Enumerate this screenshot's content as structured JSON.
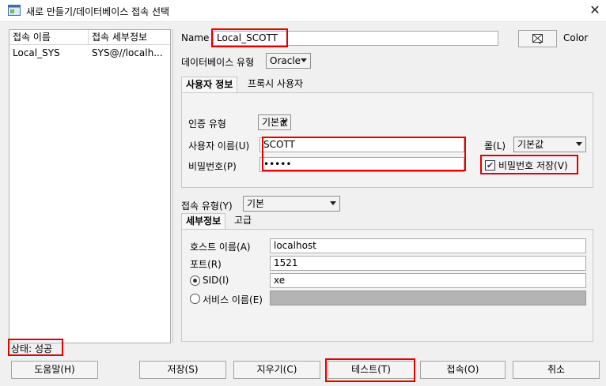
{
  "window": {
    "title": "새로 만들기/데이터베이스 접속 선택",
    "close_glyph": "✕"
  },
  "connections": {
    "headers": [
      "접속 이름",
      "접속 세부정보"
    ],
    "rows": [
      [
        "Local_SYS",
        "SYS@//localh..."
      ]
    ]
  },
  "form": {
    "name_label": "Name",
    "name_value": "Local_SCOTT",
    "color_label": "Color",
    "db_type_label": "데이터베이스 유형",
    "db_type_value": "Oracle",
    "user_tabs": [
      "사용자 정보",
      "프록시 사용자"
    ],
    "auth_type_label": "인증 유형",
    "auth_type_value": "기본값",
    "username_label": "사용자 이름(U)",
    "username_value": "SCOTT",
    "password_label": "비밀번호(P)",
    "password_value": "•••••",
    "role_label": "롤(L)",
    "role_value": "기본값",
    "save_password_label": "비밀번호 저장(V)",
    "save_password_checked": true,
    "conn_type_label": "접속 유형(Y)",
    "conn_type_value": "기본",
    "detail_tabs": [
      "세부정보",
      "고급"
    ],
    "host_label": "호스트 이름(A)",
    "host_value": "localhost",
    "port_label": "포트(R)",
    "port_value": "1521",
    "sid_label": "SID(I)",
    "sid_value": "xe",
    "service_label": "서비스 이름(E)",
    "service_value": ""
  },
  "status": {
    "text": "상태: 성공"
  },
  "buttons": {
    "help": "도움말(H)",
    "save": "저장(S)",
    "clear": "지우기(C)",
    "test": "테스트(T)",
    "connect": "접속(O)",
    "cancel": "취소"
  },
  "colors": {
    "highlight": "#e00000"
  }
}
